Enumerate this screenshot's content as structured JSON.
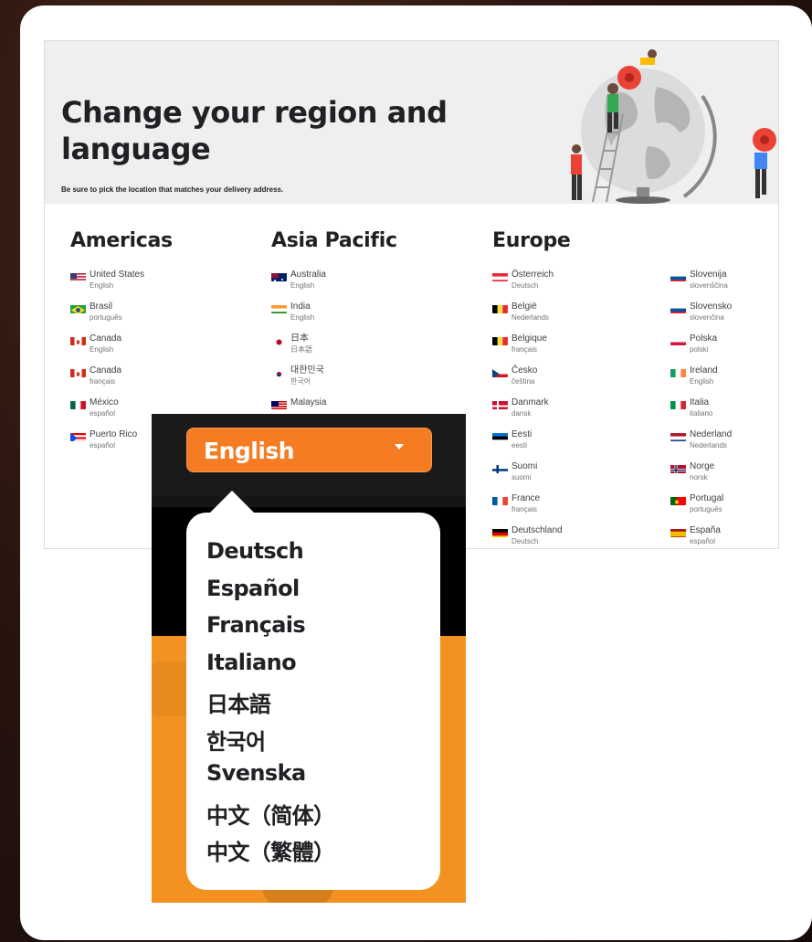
{
  "hero": {
    "title": "Change your region and language",
    "subtitle": "Be sure to pick the location that matches your delivery address."
  },
  "regions": {
    "americas": {
      "heading": "Americas",
      "items": [
        {
          "name": "United States",
          "lang": "English",
          "flag": "us"
        },
        {
          "name": "Brasil",
          "lang": "português",
          "flag": "br"
        },
        {
          "name": "Canada",
          "lang": "English",
          "flag": "ca"
        },
        {
          "name": "Canada",
          "lang": "français",
          "flag": "ca"
        },
        {
          "name": "México",
          "lang": "español",
          "flag": "mx"
        },
        {
          "name": "Puerto Rico",
          "lang": "español",
          "flag": "pr"
        }
      ]
    },
    "asia_pacific": {
      "heading": "Asia Pacific",
      "items": [
        {
          "name": "Australia",
          "lang": "English",
          "flag": "au"
        },
        {
          "name": "India",
          "lang": "English",
          "flag": "in"
        },
        {
          "name": "日本",
          "lang": "日本語",
          "flag": "jp"
        },
        {
          "name": "대한민국",
          "lang": "한국어",
          "flag": "kr"
        },
        {
          "name": "Malaysia",
          "lang": "",
          "flag": "my"
        }
      ]
    },
    "europe": {
      "heading": "Europe",
      "items": [
        {
          "name": "Österreich",
          "lang": "Deutsch",
          "flag": "at"
        },
        {
          "name": "België",
          "lang": "Nederlands",
          "flag": "be"
        },
        {
          "name": "Belgique",
          "lang": "français",
          "flag": "be"
        },
        {
          "name": "Česko",
          "lang": "čeština",
          "flag": "cz"
        },
        {
          "name": "Danmark",
          "lang": "dansk",
          "flag": "dk"
        },
        {
          "name": "Eesti",
          "lang": "eesti",
          "flag": "ee"
        },
        {
          "name": "Suomi",
          "lang": "suomi",
          "flag": "fi"
        },
        {
          "name": "France",
          "lang": "français",
          "flag": "fr"
        },
        {
          "name": "Deutschland",
          "lang": "Deutsch",
          "flag": "de"
        }
      ],
      "items2": [
        {
          "name": "Slovenija",
          "lang": "slovenščina",
          "flag": "si"
        },
        {
          "name": "Slovensko",
          "lang": "slovenčina",
          "flag": "sk"
        },
        {
          "name": "Polska",
          "lang": "polski",
          "flag": "pl"
        },
        {
          "name": "Ireland",
          "lang": "English",
          "flag": "ie"
        },
        {
          "name": "Italia",
          "lang": "italiano",
          "flag": "it"
        },
        {
          "name": "Nederland",
          "lang": "Nederlands",
          "flag": "nl"
        },
        {
          "name": "Norge",
          "lang": "norsk",
          "flag": "no"
        },
        {
          "name": "Portugal",
          "lang": "português",
          "flag": "pt"
        },
        {
          "name": "España",
          "lang": "español",
          "flag": "es"
        }
      ]
    }
  },
  "language_dropdown": {
    "selected": "English",
    "caret_icon": "caret-down-icon",
    "options": [
      "Deutsch",
      "Español",
      "Français",
      "Italiano",
      "日本語",
      "한국어",
      "Svenska",
      "中文（简体）",
      "中文（繁體）"
    ],
    "colors": {
      "button": "#f57c22",
      "background_orange": "#f39221"
    }
  }
}
